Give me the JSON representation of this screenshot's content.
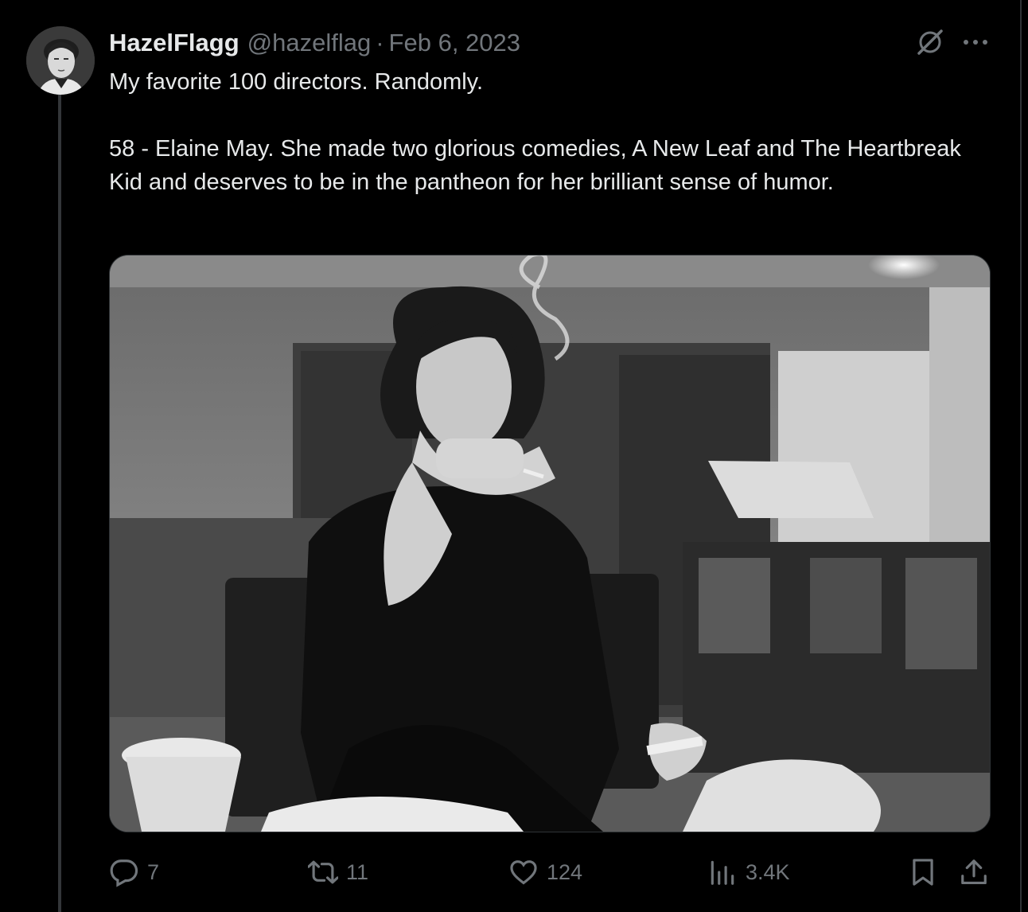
{
  "post": {
    "author": {
      "display_name": "HazelFlagg",
      "handle": "@hazelflag",
      "avatar_icon": "avatar-portrait"
    },
    "separator": "·",
    "date": "Feb 6, 2023",
    "text": {
      "line1": "My favorite 100 directors. Randomly.",
      "line2": "58 - Elaine May. She made two glorious comedies, A New Leaf and The Heartbreak Kid and deserves to be in the pantheon for her brilliant sense of humor."
    },
    "media": {
      "kind": "black-and-white photo"
    },
    "stats": {
      "replies": "7",
      "reposts": "11",
      "likes": "124",
      "views": "3.4K"
    }
  },
  "icons": {
    "grok": "grok-icon",
    "more": "more-icon",
    "reply": "reply-icon",
    "repost": "repost-icon",
    "like": "heart-icon",
    "views": "views-icon",
    "bookmark": "bookmark-icon",
    "share": "share-icon"
  },
  "colors": {
    "background": "#000000",
    "text_primary": "#e7e9ea",
    "text_secondary": "#71767b",
    "border": "#2f3336"
  }
}
